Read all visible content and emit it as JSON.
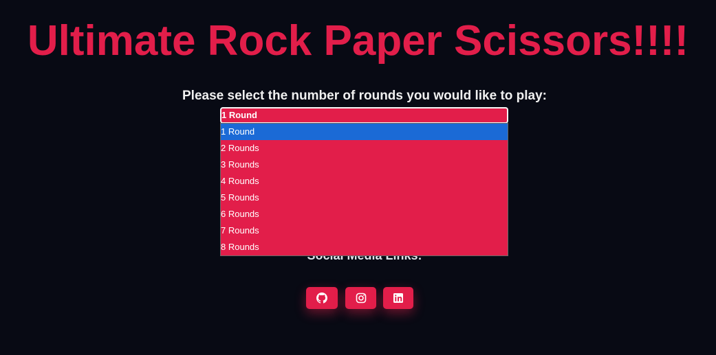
{
  "title": "Ultimate Rock Paper Scissors!!!!",
  "prompt": "Please select the number of rounds you would like to play:",
  "rounds_select": {
    "selected": "1 Round",
    "options": [
      "1 Round",
      "2 Rounds",
      "3 Rounds",
      "4 Rounds",
      "5 Rounds",
      "6 Rounds",
      "7 Rounds",
      "8 Rounds"
    ],
    "highlighted_index": 0
  },
  "social": {
    "heading": "Social Media Links:",
    "links": [
      {
        "icon": "github-icon"
      },
      {
        "icon": "instagram-icon"
      },
      {
        "icon": "linkedin-icon"
      }
    ]
  },
  "colors": {
    "accent": "#e21e4a",
    "background": "#080a14",
    "highlight": "#1b6ad6"
  }
}
